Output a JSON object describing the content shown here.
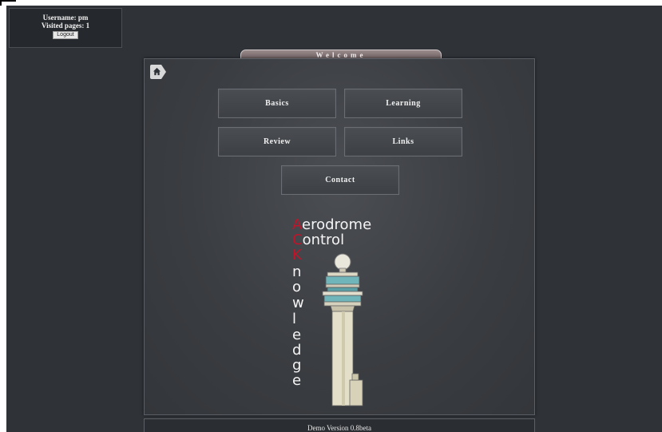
{
  "user": {
    "username": "Username: pm",
    "visited": "Visited pages: 1",
    "logout": "Logout"
  },
  "header": {
    "tab_title": "Welcome"
  },
  "nav": {
    "basics": "Basics",
    "learning": "Learning",
    "review": "Review",
    "links": "Links",
    "contact": "Contact"
  },
  "logo": {
    "line1_initial": "A",
    "line1_rest": "erodrome",
    "line2_initial": "C",
    "line2_rest": "ontrol",
    "line3_initial": "K",
    "letters": [
      "n",
      "o",
      "w",
      "l",
      "e",
      "d",
      "g",
      "e"
    ]
  },
  "footer": {
    "version": "Demo Version 0.8beta"
  },
  "colors": {
    "background": "#2f3338",
    "accent_red": "#c0142a",
    "text": "#f0f0f0"
  },
  "icons": {
    "home": "home-icon",
    "tower": "control-tower-illustration"
  }
}
